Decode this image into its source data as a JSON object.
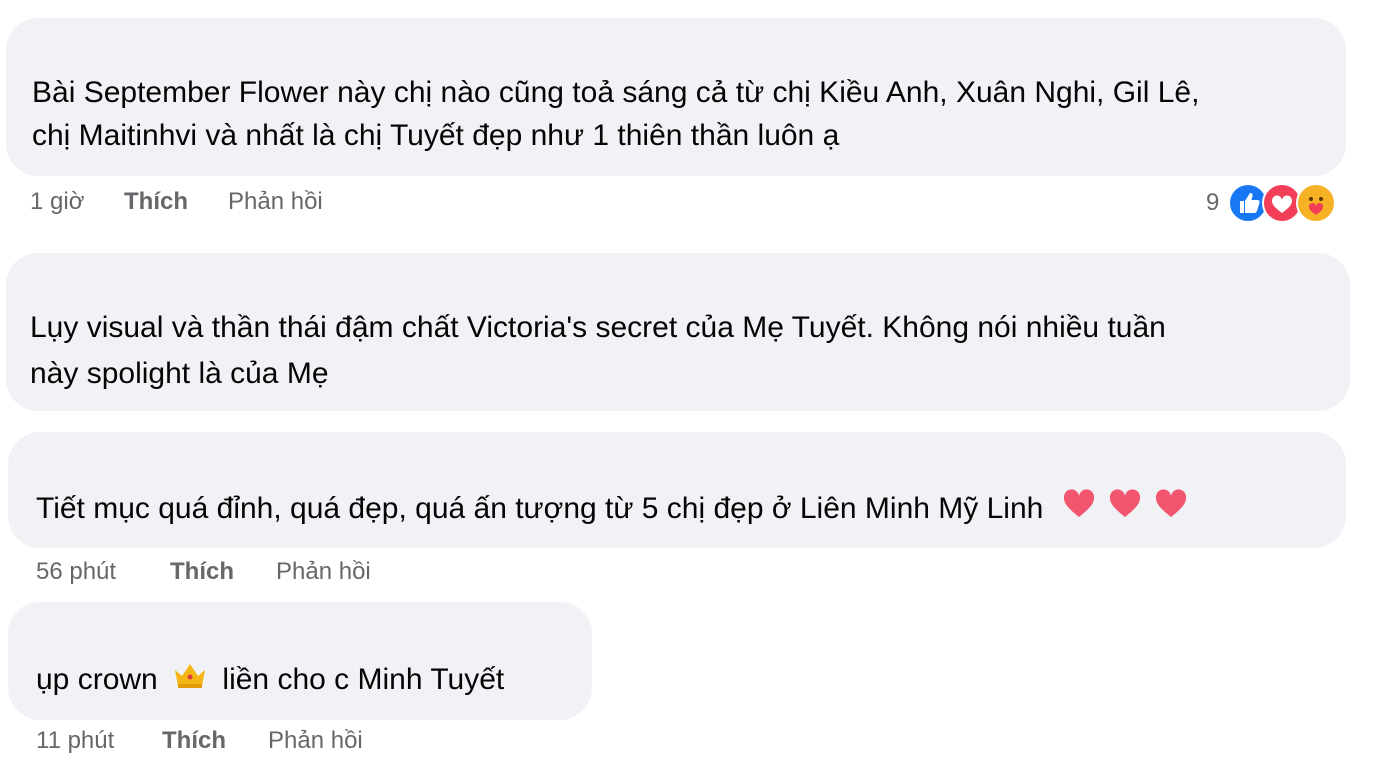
{
  "comments": [
    {
      "lines": [
        "Bài September Flower này chị nào cũng toả sáng cả từ chị Kiều Anh, Xuân Nghi, Gil Lê,",
        "chị Maitinhvi và nhất là chị Tuyết đẹp như 1 thiên thần luôn ạ"
      ],
      "time": "1 giờ",
      "like_label": "Thích",
      "reply_label": "Phản hồi",
      "reaction_count": "9",
      "reactions": [
        "like-icon",
        "love-icon",
        "care-icon"
      ]
    },
    {
      "lines": [
        "Lụy visual và thần thái đậm chất Victoria's secret của Mẹ Tuyết. Không nói nhiều tuần",
        "này spolight là của Mẹ"
      ]
    },
    {
      "text": "Tiết mục quá đỉnh, quá đẹp, quá ấn tượng từ 5 chị đẹp ở Liên Minh Mỹ Linh",
      "emoji": [
        "heart-icon",
        "heart-icon",
        "heart-icon"
      ],
      "time": "56 phút",
      "like_label": "Thích",
      "reply_label": "Phản hồi"
    },
    {
      "text_before": "ụp crown",
      "emoji": "crown-icon",
      "text_after": "liền cho c Minh Tuyết",
      "time": "11 phút",
      "like_label": "Thích",
      "reply_label": "Phản hồi"
    }
  ],
  "colors": {
    "bubble": "#f0f2f5",
    "meta_text": "#65676b",
    "like_blue": "#1877f2",
    "love_red": "#f33e58",
    "care_yellow": "#f7b125"
  }
}
